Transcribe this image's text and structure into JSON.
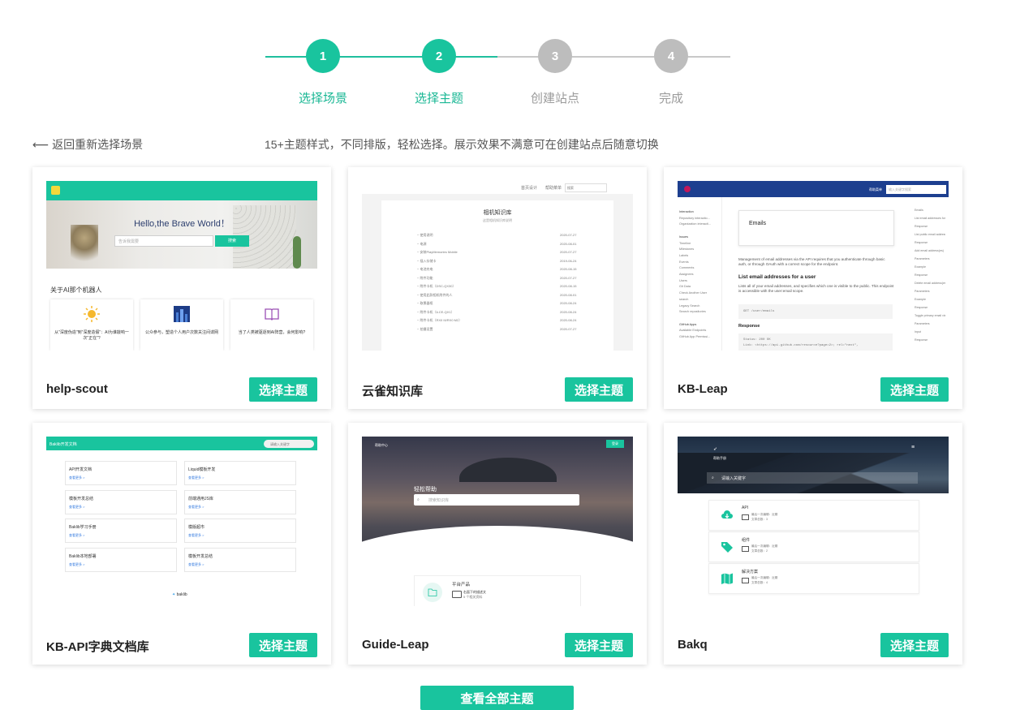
{
  "colors": {
    "accent": "#19c49e",
    "inactive": "#bdbdbd"
  },
  "steps": [
    {
      "number": "1",
      "label": "选择场景",
      "state": "active"
    },
    {
      "number": "2",
      "label": "选择主题",
      "state": "active"
    },
    {
      "number": "3",
      "label": "创建站点",
      "state": "inactive"
    },
    {
      "number": "4",
      "label": "完成",
      "state": "inactive"
    }
  ],
  "back_link": {
    "icon": "arrow-left-icon",
    "label": "返回重新选择场景"
  },
  "subtitle": "15+主题样式，不同排版，轻松选择。展示效果不满意可在创建站点后随意切换",
  "choose_label": "选择主题",
  "view_all_label": "查看全部主题",
  "themes": [
    {
      "name": "help-scout",
      "preview": {
        "hero_title": "Hello,the Brave World！",
        "search_placeholder": "告诉我需要",
        "search_button": "搜索",
        "section_title": "关于AI那个机器人",
        "tiles": [
          {
            "icon": "sun-icon",
            "text": "从\"深度伪造\"到\"深度造假\"：AI为谁敲响一次\"正在\"?"
          },
          {
            "icon": "city-icon",
            "text": "公众参与，塑造个人用户次数关注间谍网"
          },
          {
            "icon": "book-icon",
            "text": "当了人类被驱逐到AI阵营，会何影响?"
          }
        ]
      }
    },
    {
      "name": "云雀知识库",
      "preview": {
        "nav": [
          "首页设计",
          "帮助菜单"
        ],
        "search_placeholder": "搜索",
        "title": "相机知识库",
        "subtitle": "这是相机知识库说明",
        "rows": [
          {
            "label": "− 使用说明",
            "date": "2020-07-27"
          },
          {
            "label": "− 电源",
            "date": "2020-08-01"
          },
          {
            "label": "− 安装PlayMemories Mobile",
            "date": "2020-07-27"
          },
          {
            "label": "− 插入存储卡",
            "date": "2019-06-24"
          },
          {
            "label": "− 电池充电",
            "date": "2020-08-15"
          },
          {
            "label": "− 附件功能",
            "date": "2020-07-27"
          },
          {
            "label": "− 附件卡机（DSC-QX30）",
            "date": "2020-08-15"
          },
          {
            "label": "− 使用此款相机附件的人",
            "date": "2020-08-01"
          },
          {
            "label": "− 取景器框",
            "date": "2020-08-24"
          },
          {
            "label": "− 附件卡机（ILCE-QX1）",
            "date": "2020-08-24"
          },
          {
            "label": "− 附件卡机（RX0 III/RX0 M2）",
            "date": "2020-08-24"
          },
          {
            "label": "− 拍摄设置",
            "date": "2020-07-27"
          }
        ]
      }
    },
    {
      "name": "KB-Leap",
      "preview": {
        "nav_link": "帮助菜单",
        "search_placeholder": "输入关键字搜索",
        "sidebar": [
          "Interaction",
          "Repository interactio...",
          "Organization interacti...",
          "",
          "Issues",
          "Timeline",
          "Milestones",
          "Labels",
          "Events",
          "Comments",
          "Assignees",
          "Users",
          "Git Data",
          "Check Another User",
          "search",
          "Legacy Search",
          "Search repositories",
          "",
          "GitHub Apps",
          "Available Endpoints",
          "GitHub App Permissi..."
        ],
        "box_title": "Emails",
        "para1": "Management of email addresses via the API requires that you authenticate through basic auth, or through OAuth with a correct scope for the endpoint.",
        "h_list": "List email addresses for a user",
        "para2": "Lists all of your email addresses, and specifies which one is visible to the public. This endpoint is accessible with the user:email scope.",
        "code1": "GET /user/emails",
        "h_resp": "Response",
        "code2": "Status: 200 OK",
        "code3": "Link: <https://api.github.com/resource?page=2>; rel=\"next\",",
        "toc": [
          "Emails",
          "List email addresses for a user",
          "Response",
          "List public email addresses for a user",
          "Response",
          "Add email address(es)",
          "Parameters",
          "Example",
          "Response",
          "Delete email address(es)",
          "Parameters",
          "Example",
          "Response",
          "Toggle primary email visibility",
          "Parameters",
          "Input",
          "Response"
        ]
      }
    },
    {
      "name": "KB-API字典文档库",
      "preview": {
        "brand": "Baklib开发文档",
        "search_placeholder": "请输入关键字",
        "more": "查看更多 >",
        "boxes": [
          "API开发文档",
          "Liquid模板开发",
          "模板开发总结",
          "前端通用JS库",
          "Baklib学习手册",
          "模版超市",
          "Baklib本地部署",
          "模板开发总结"
        ],
        "footer": "baklib"
      }
    },
    {
      "name": "Guide-Leap",
      "preview": {
        "brand": "帮助中心",
        "top_button": "登录",
        "hero_title": "轻松帮助",
        "search_placeholder": "搜索知识库",
        "card_title": "平台产品",
        "card_item": "右面下的描述文",
        "card_sub": "5 个相关资料"
      }
    },
    {
      "name": "Bakq",
      "preview": {
        "brand": "帮助手册",
        "search_placeholder": "请输入关键字",
        "rows": [
          {
            "icon": "cloud-download-icon",
            "title": "API",
            "meta": "最后一次编辑：近期",
            "count": "文章总数：3"
          },
          {
            "icon": "tag-icon",
            "title": "组件",
            "meta": "最后一次编辑：近期",
            "count": "文章总数：2"
          },
          {
            "icon": "map-icon",
            "title": "解决方案",
            "meta": "最后一次编辑：近期",
            "count": "文章总数：4"
          }
        ]
      }
    }
  ]
}
